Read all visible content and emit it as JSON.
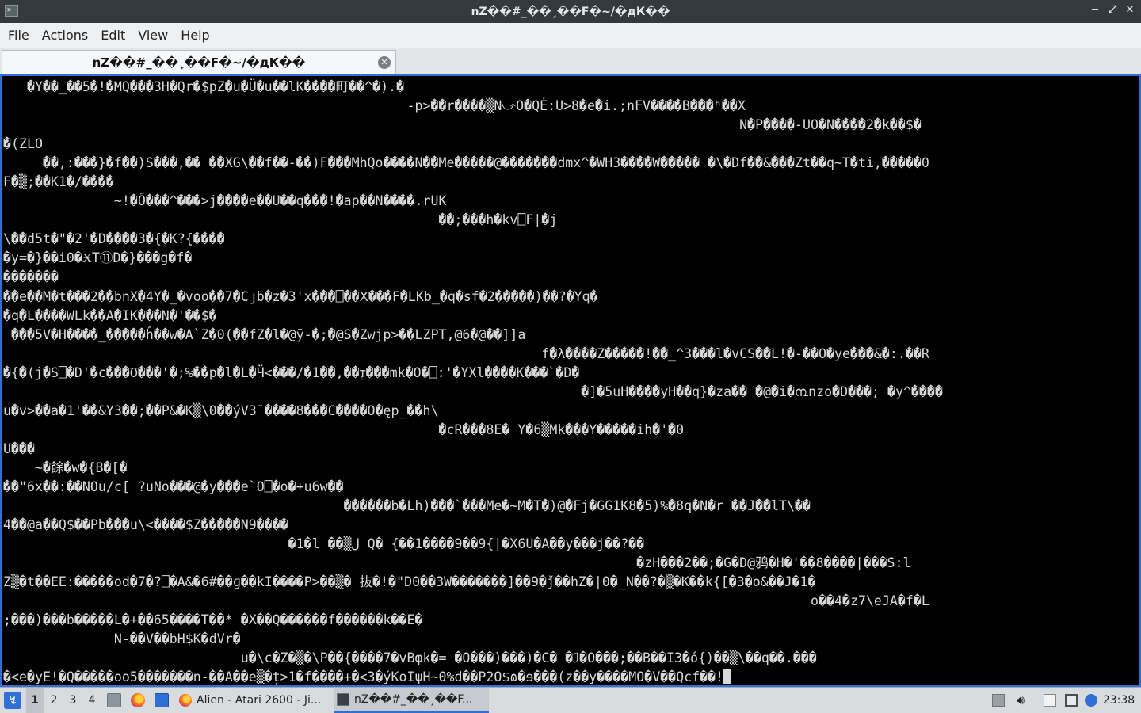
{
  "window": {
    "title": "nZ��#_��ˏ��F�~/�дК��",
    "controls": [
      "−",
      "⤢",
      "✕"
    ]
  },
  "menu": [
    "File",
    "Actions",
    "Edit",
    "View",
    "Help"
  ],
  "tab": {
    "label": "nZ��#_��ˏ��F�~/�дК��",
    "close": "✕"
  },
  "terminal": {
    "lines": [
      "   �Y��_��5�!�MQ���3H�Qr�$pZ�u�Ü�u��lK����町��^�).�",
      "                                                   -p>��r����▒N⤻O�QĖ:U>8�e�i.;nFV����B���ʰ��X",
      "                                                                                             N�P����-UO�N����2�k��$�",
      "�(ZLO",
      "     ��,:���}�f��)S���,�� ��XG\\��f��-��)F���MhQo����N��Me�����@�������dmx^�WH3����W����� �\\�Df��&���Zt��q~T�ti,�����0",
      "F�▒;��K1�/����",
      "              ~!�Ő���^���>j����e��U��q���!�ap��N����.rUK",
      "                                                       ��;���h�kv⎕F|�j",
      "\\��d5t�\"�2'�D����3�{�K?{����",
      "�y=�}��i0�ӾT⑪D�}���g�f�",
      "�������",
      "��e��M�t���2��bnX�4Y�_�voo��7�Cյb�z�3'x���⎕��Ⅹ���F�LKb_�q�sf�2�����)��?�Yq�",
      "�q�L����WLk��A�IK���N�'��$�",
      " ���5V�H����_�����ĥ��w�A`Z�0(��fZ�l�@ӯ-�;�@S�Zwjp>��LZPT,@6�@��]]a",
      "                                                                    f�λ����Z�����!��_^3���l�vCS��L!�-��O�ye���&�:.��R",
      "�{�(j�S⎕�D'�c���Ʊ���'�;%��p�l�L�Ӵ<���/�1��,��ꚑ���mk�O�⎕:'�YXl����K���`�D�",
      "                                                                         �]�5uH����yH��q}�za�� �@�i�൩nzo�D���; �y^����",
      "u�v>��a�1'��&Y3��;��P&�K▒\\0��ýV3¨����8���C����O�ęp_��h\\",
      "                                                       �cR���8E� Y�6▒Mk���Y�����ih�'�0",
      "U���",
      "    ~�餘�w�{B�[�",
      "��\"6x��:��NOu/c[ ?uNo���@�y���e`O⎕�o�+u6w��",
      "                                           ������b�Lh)���`���Me�~M�T�)@�Fj�GG1K8�5)%�8q�N�r ��J��lT\\��",
      "4��@a��Q$��Pb���u\\<����$Z�����N9����",
      "                                    �1�l ��▒ل Q� {��1����9��9{|�X6U�A��y���j��?��",
      "                                                                                �zH���2��;�G�D@鸦�H�'��8����|���S:l",
      "Z▒�t��EE؛�����od�7�?⎕�A&�6#��ɡ��kI����P>��▒� 抜�!�\"D0��3W�������]��9�ǰ��hZ�|0�_N��?�▒�K��k{[�3�o&��J�1�",
      "                                                                                                      o��4�z7\\eJA�f�L",
      ";���)���b�����L�+��65����T��* �X��Q������f������k��E�",
      "              N-��V��bH$K�dVr�",
      "                              u�\\c�Z�▒�\\P��{����7�vBφk�= �O���)���)�C� �ℐ�O���;��B��I3�ó{)��▒\\��q��.���",
      "�<e�yE!�Q�����oo5�������n-��A��e▒�ț>1�f����+�<3�ýKoIψH~0%d��P2Օ$ɷ�ɘ���(z��y����MO�V��Qcf��!"
    ]
  },
  "taskbar": {
    "workspaces": [
      "1",
      "2",
      "3",
      "4"
    ],
    "active_workspace": "1",
    "quicklaunch": [
      "file-manager-icon",
      "firefox-icon",
      "desktop-icon"
    ],
    "tasks": [
      {
        "label": "Alien - Atari 2600 - Ji...",
        "icon": "firefox-icon",
        "active": false
      },
      {
        "label": "nZ��#_��ˏ��F...",
        "icon": "terminal-icon",
        "active": true
      }
    ],
    "tray": [
      "update-icon",
      "volume-icon",
      "clipboard-icon",
      "display-icon",
      "info-icon"
    ],
    "clock": "23:38"
  },
  "colors": {
    "titlebar": "#33393f",
    "accent": "#2f6fd6",
    "terminal_bg": "#000000",
    "terminal_fg": "#d8d8d8",
    "taskbar": "#d9dcdf"
  }
}
